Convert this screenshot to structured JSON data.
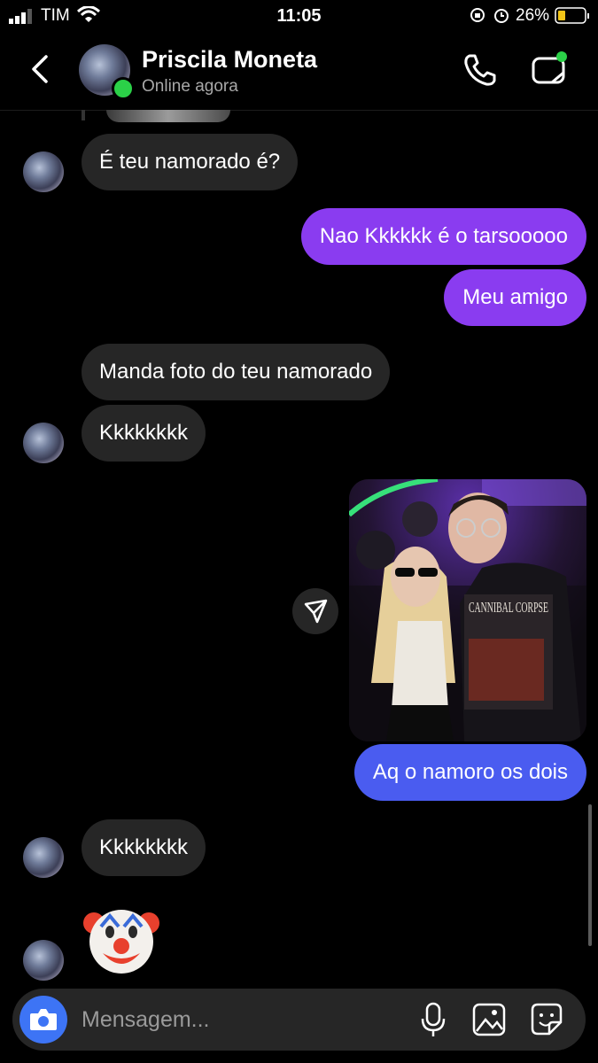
{
  "status_bar": {
    "carrier": "TIM",
    "time": "11:05",
    "battery": "26%"
  },
  "header": {
    "name": "Priscila Moneta",
    "status": "Online agora"
  },
  "messages": [
    {
      "from": "them",
      "text": "É teu namorado é?"
    },
    {
      "from": "me",
      "text": "Nao Kkkkkk é o tarsooooo"
    },
    {
      "from": "me",
      "text": "Meu amigo"
    },
    {
      "from": "them",
      "text": "Manda foto do teu namorado"
    },
    {
      "from": "them",
      "text": "Kkkkkkkk"
    },
    {
      "from": "me",
      "type": "photo",
      "shirt_text": "CANNIBAL CORPSE"
    },
    {
      "from": "me",
      "text": "Aq o namoro os dois"
    },
    {
      "from": "them",
      "text": "Kkkkkkkk"
    },
    {
      "from": "them",
      "type": "emoji",
      "emoji": "clown-face"
    }
  ],
  "composer": {
    "placeholder": "Mensagem..."
  },
  "colors": {
    "outgoing": "#8a3cf0",
    "outgoing_last": "#4a5cf0",
    "incoming": "#262626",
    "online": "#2bd148",
    "camera": "#3d74f5"
  },
  "icons": [
    "back-icon",
    "phone-icon",
    "video-call-icon",
    "share-icon",
    "camera-icon",
    "microphone-icon",
    "gallery-icon",
    "sticker-icon"
  ]
}
